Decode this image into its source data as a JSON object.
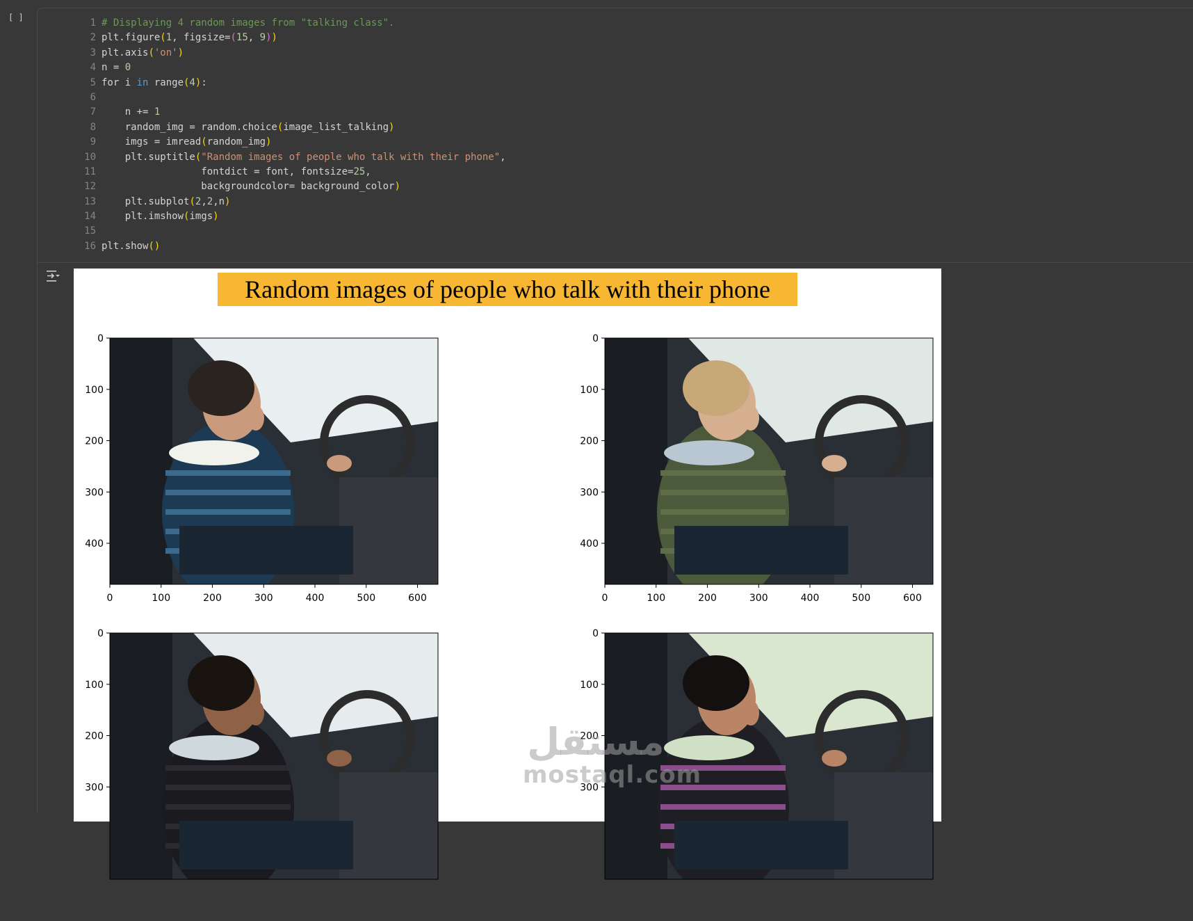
{
  "cell": {
    "bracket": "[ ]"
  },
  "code": {
    "lines": [
      {
        "n": "1"
      },
      {
        "n": "2"
      },
      {
        "n": "3"
      },
      {
        "n": "4"
      },
      {
        "n": "5"
      },
      {
        "n": "6"
      },
      {
        "n": "7"
      },
      {
        "n": "8"
      },
      {
        "n": "9"
      },
      {
        "n": "10"
      },
      {
        "n": "11"
      },
      {
        "n": "12"
      },
      {
        "n": "13"
      },
      {
        "n": "14"
      },
      {
        "n": "15"
      },
      {
        "n": "16"
      }
    ],
    "text": {
      "l1": "# Displaying 4 random images from \"talking class\".",
      "l2a": "plt.figure",
      "l2b": "(",
      "l2c": "1",
      "l2d": ", figsize=",
      "l2e": "(",
      "l2f": "15",
      "l2g": ", ",
      "l2h": "9",
      "l2i": ")",
      "l2j": ")",
      "l3a": "plt.axis",
      "l3b": "(",
      "l3c": "'on'",
      "l3d": ")",
      "l4a": "n = ",
      "l4b": "0",
      "l5a": "for i ",
      "l5b": "in",
      "l5c": " range",
      "l5d": "(",
      "l5e": "4",
      "l5f": ")",
      "l5g": ":",
      "l7a": "    n += ",
      "l7b": "1",
      "l8a": "    random_img = random.choice",
      "l8b": "(",
      "l8c": "image_list_talking",
      "l8d": ")",
      "l9a": "    imgs = imread",
      "l9b": "(",
      "l9c": "random_img",
      "l9d": ")",
      "l10a": "    plt.suptitle",
      "l10b": "(",
      "l10c": "\"Random images of people who talk with their phone\"",
      "l10d": ",",
      "l11a": "                 fontdict = font, fontsize=",
      "l11b": "25",
      "l11c": ",",
      "l12a": "                 backgroundcolor= background_color",
      "l12b": ")",
      "l13a": "    plt.subplot",
      "l13b": "(",
      "l13c": "2",
      "l13d": ",",
      "l13e": "2",
      "l13f": ",n",
      "l13g": ")",
      "l14a": "    plt.imshow",
      "l14b": "(",
      "l14c": "imgs",
      "l14d": ")",
      "l16a": "plt.show",
      "l16b": "(",
      "l16c": ")"
    }
  },
  "output": {
    "suptitle": "Random images of people who talk with their phone",
    "suptitle_bg": "#f7b733"
  },
  "chart_data": [
    {
      "type": "image",
      "title": "",
      "xlabel": "",
      "ylabel": "",
      "xticks": [
        0,
        100,
        200,
        300,
        400,
        500,
        600
      ],
      "yticks": [
        0,
        100,
        200,
        300,
        400
      ],
      "xlim": [
        0,
        640
      ],
      "ylim": [
        480,
        0
      ]
    },
    {
      "type": "image",
      "title": "",
      "xlabel": "",
      "ylabel": "",
      "xticks": [
        0,
        100,
        200,
        300,
        400,
        500,
        600
      ],
      "yticks": [
        0,
        100,
        200,
        300,
        400
      ],
      "xlim": [
        0,
        640
      ],
      "ylim": [
        480,
        0
      ]
    },
    {
      "type": "image",
      "title": "",
      "xlabel": "",
      "ylabel": "",
      "xticks": [],
      "yticks": [
        0,
        100,
        200,
        300
      ],
      "xlim": [
        0,
        640
      ],
      "ylim": [
        480,
        0
      ]
    },
    {
      "type": "image",
      "title": "",
      "xlabel": "",
      "ylabel": "",
      "xticks": [],
      "yticks": [
        0,
        100,
        200,
        300
      ],
      "xlim": [
        0,
        640
      ],
      "ylim": [
        480,
        0
      ]
    }
  ],
  "watermark": {
    "arabic": "مستقل",
    "latin": "mostaql.com"
  }
}
